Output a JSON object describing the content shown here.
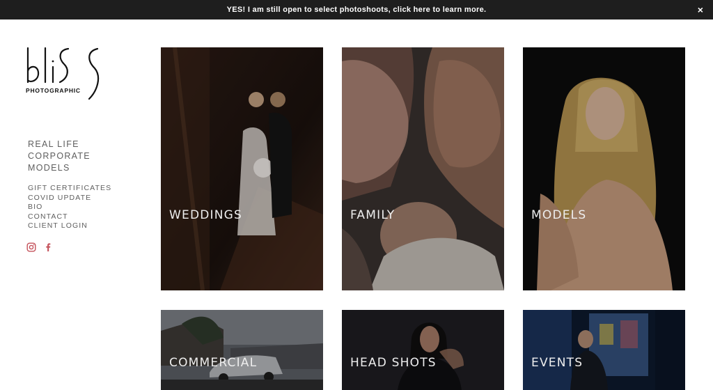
{
  "banner": {
    "text": "YES! I am still open to select photoshoots, click here to learn more.",
    "close_glyph": "×"
  },
  "logo": {
    "wordmark": "bliss",
    "subtitle": "PHOTOGRAPHIC"
  },
  "nav": {
    "primary": [
      "REAL LIFE",
      "CORPORATE",
      "MODELS"
    ],
    "secondary": [
      "GIFT CERTIFICATES",
      "COVID UPDATE",
      "BIO",
      "CONTACT",
      "CLIENT LOGIN"
    ]
  },
  "social": {
    "icons": [
      "instagram-icon",
      "facebook-icon"
    ],
    "color": "#c4515a"
  },
  "tiles": [
    {
      "label": "WEDDINGS"
    },
    {
      "label": "FAMILY"
    },
    {
      "label": "MODELS"
    },
    {
      "label": "COMMERCIAL"
    },
    {
      "label": "HEAD SHOTS"
    },
    {
      "label": "EVENTS"
    }
  ],
  "colors": {
    "banner_bg": "#1e1e1e",
    "nav_text": "#5e5e5e",
    "page_bg": "#ffffff"
  }
}
